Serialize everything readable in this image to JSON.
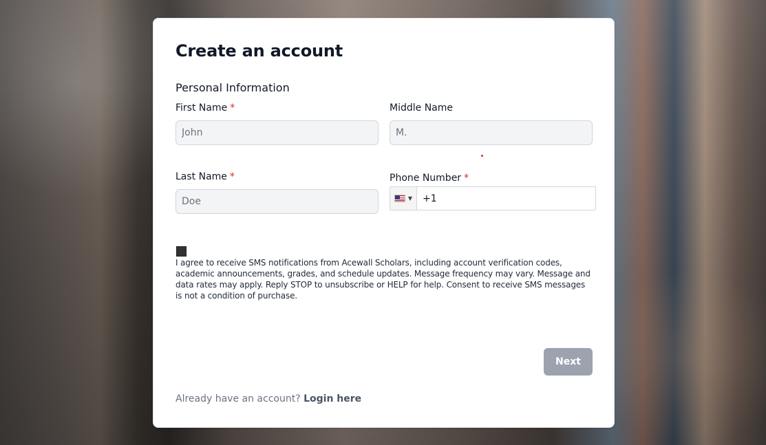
{
  "form": {
    "title": "Create an account",
    "section_title": "Personal Information",
    "required_marker": "*",
    "fields": {
      "first_name": {
        "label": "First Name",
        "placeholder": "John",
        "value": ""
      },
      "middle_name": {
        "label": "Middle Name",
        "placeholder": "M.",
        "value": ""
      },
      "last_name": {
        "label": "Last Name",
        "placeholder": "Doe",
        "value": ""
      },
      "phone": {
        "label": "Phone Number",
        "country_code": "+1",
        "flag_icon": "us-flag-icon"
      }
    },
    "consent_text": "I agree to receive SMS notifications from Acewall Scholars, including account verification codes, academic announcements, grades, and schedule updates. Message frequency may vary. Message and data rates may apply. Reply STOP to unsubscribe or HELP for help. Consent to receive SMS messages is not a condition of purchase.",
    "next_label": "Next",
    "login_prompt": "Already have an account?",
    "login_link": "Login here"
  },
  "colors": {
    "required": "#dc2626",
    "button_disabled": "#9ca3af",
    "card": "#ffffff",
    "input_bg": "#f3f4f6"
  }
}
